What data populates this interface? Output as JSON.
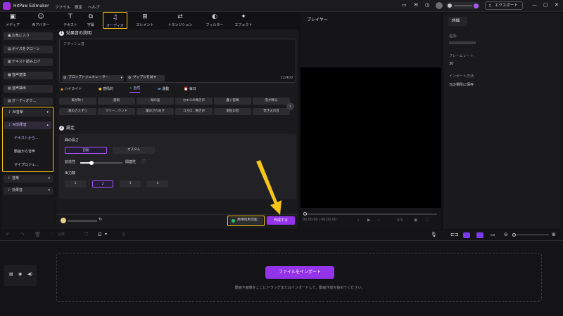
{
  "app": {
    "title": "HitPaw Edimakor"
  },
  "menu": [
    "ファイル",
    "設定",
    "ヘルプ"
  ],
  "titlebar": {
    "export_label": "エクスポート"
  },
  "toolbar": [
    {
      "label": "メディア",
      "icon": "media-icon"
    },
    {
      "label": "AIアバター",
      "icon": "avatar-icon"
    },
    {
      "label": "テキスト",
      "icon": "text-icon"
    },
    {
      "label": "字幕",
      "icon": "subtitle-icon"
    },
    {
      "label": "オーディオ",
      "icon": "audio-icon",
      "active": true
    },
    {
      "label": "エレメント",
      "icon": "element-icon"
    },
    {
      "label": "トランジション",
      "icon": "transition-icon"
    },
    {
      "label": "フィルター",
      "icon": "filter-icon"
    },
    {
      "label": "エフェクト",
      "icon": "effect-icon"
    }
  ],
  "sidebar": {
    "items": [
      {
        "label": "お気に入り",
        "icon": "▣"
      },
      {
        "label": "ボイスをクローン",
        "icon": "▤"
      },
      {
        "label": "テキスト読み上げ",
        "icon": "▦"
      },
      {
        "label": "音声変換",
        "icon": "▩"
      },
      {
        "label": "音声抽出",
        "icon": "▧"
      },
      {
        "label": "オーディオク...",
        "icon": "▨"
      }
    ],
    "ai_music": "AI音楽",
    "ai_sfx": "AI効果音",
    "sub": [
      "テキストから...",
      "動画から音声",
      "マイプロジェ..."
    ],
    "music": "音楽",
    "sfx": "効果音"
  },
  "section1": {
    "num": "1",
    "title": "効果音の説明",
    "placeholder": "フラッシュ音",
    "prompt_gen": "プロンプトジェネレーター",
    "sample": "サンプルを試す",
    "counter": "12/400"
  },
  "categories": [
    "ハイライト",
    "感情的",
    "自然",
    "運動",
    "毎日"
  ],
  "presets": [
    [
      "風が吹く",
      "雷雨",
      "海の波",
      "カエルの鳴き声",
      "轟く雷鳴",
      "雪が降る"
    ],
    [
      "葉のさえずり",
      "クリー...ウンド",
      "葉のざわめき",
      "コオロ...鳴き声",
      "雨粒の音",
      "焚き火の音"
    ]
  ],
  "section2": {
    "num": "2",
    "title": "設定",
    "length_label": "曲の長さ",
    "auto": "自動",
    "custom": "カスタム",
    "creativity": "創造性",
    "relevance": "関連性",
    "output_label": "出力数",
    "outputs": [
      "1",
      "2",
      "3",
      "4"
    ]
  },
  "bottom": {
    "commercial": "商用利用可能",
    "create": "作成する"
  },
  "player": {
    "title": "プレイヤー",
    "time": "00:00:00 / 00:00:00",
    "ratio": "4:3"
  },
  "details": {
    "tab": "詳細",
    "name_label": "名前:",
    "fps_label": "フレームレート:",
    "fps_value": "30",
    "import_label": "インポート方法:",
    "import_value": "元の場所に保存"
  },
  "timeline": {
    "merge": "合併",
    "import_button": "ファイルをインポート",
    "hint": "動画や画像をここにドラッグまたはインポートして、動画作成を始めてください。"
  },
  "colors": {
    "accent": "#a855f7",
    "highlight": "#f5c518"
  }
}
